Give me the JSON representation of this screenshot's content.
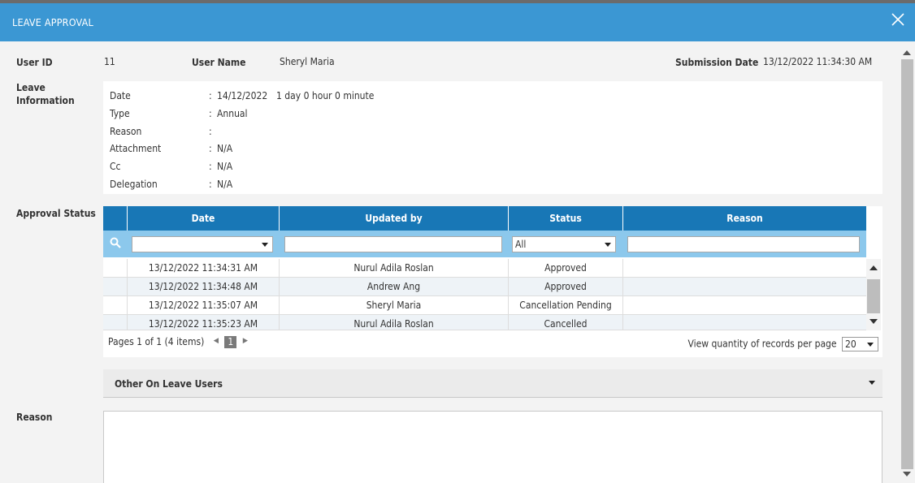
{
  "window": {
    "title": "LEAVE APPROVAL"
  },
  "header": {
    "user_id_label": "User ID",
    "user_id": "11",
    "user_name_label": "User Name",
    "user_name": "Sheryl Maria",
    "submission_date_label": "Submission Date",
    "submission_date": "13/12/2022 11:34:30 AM"
  },
  "leave_info": {
    "label_line1": "Leave",
    "label_line2": "Information",
    "rows": [
      {
        "key": "Date",
        "value": "14/12/2022",
        "extra": "1 day 0 hour 0 minute"
      },
      {
        "key": "Type",
        "value": "Annual",
        "extra": ""
      },
      {
        "key": "Reason",
        "value": "",
        "extra": ""
      },
      {
        "key": "Attachment",
        "value": "N/A",
        "extra": ""
      },
      {
        "key": "Cc",
        "value": "N/A",
        "extra": ""
      },
      {
        "key": "Delegation",
        "value": "N/A",
        "extra": ""
      }
    ]
  },
  "approval": {
    "label": "Approval Status",
    "columns": [
      "Date",
      "Updated by",
      "Status",
      "Reason"
    ],
    "status_filter": "All",
    "rows": [
      {
        "date": "13/12/2022 11:34:31 AM",
        "updated_by": "Nurul Adila Roslan",
        "status": "Approved",
        "reason": ""
      },
      {
        "date": "13/12/2022 11:34:48 AM",
        "updated_by": "Andrew Ang",
        "status": "Approved",
        "reason": ""
      },
      {
        "date": "13/12/2022 11:35:07 AM",
        "updated_by": "Sheryl Maria",
        "status": "Cancellation Pending",
        "reason": ""
      },
      {
        "date": "13/12/2022 11:35:23 AM",
        "updated_by": "Nurul Adila Roslan",
        "status": "Cancelled",
        "reason": ""
      }
    ],
    "pager_text": "Pages 1 of 1 (4 items)",
    "current_page": "1",
    "per_page_label": "View quantity of records per page",
    "per_page_value": "20"
  },
  "other_on_leave": {
    "label": "Other On Leave Users"
  },
  "reason": {
    "label": "Reason"
  },
  "colors": {
    "titlebar": "#3b97d3",
    "grid_header": "#1877b6",
    "filter_row": "#8cc8ec"
  }
}
